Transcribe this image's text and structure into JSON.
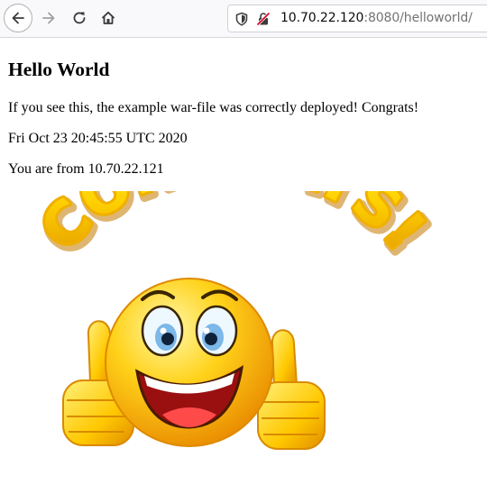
{
  "browser": {
    "url_host": "10.70.22.120",
    "url_rest": ":8080/helloworld/",
    "icons": {
      "back": "back-arrow-icon",
      "forward": "forward-arrow-icon",
      "reload": "reload-icon",
      "home": "home-icon",
      "tracking": "shield-icon",
      "security": "insecure-lock-icon"
    }
  },
  "page": {
    "heading": "Hello World",
    "message": "If you see this, the example war-file was correctly deployed! Congrats!",
    "timestamp": "Fri Oct 23 20:45:55 UTC 2020",
    "client_line": "You are from 10.70.22.121",
    "image_text": "CONGRATS!"
  },
  "colors": {
    "letter_fill": "#ffd200",
    "letter_shade": "#e8a200",
    "face": "#ffcf1a",
    "mouth": "#b01818",
    "tongue": "#ff4a4a"
  }
}
